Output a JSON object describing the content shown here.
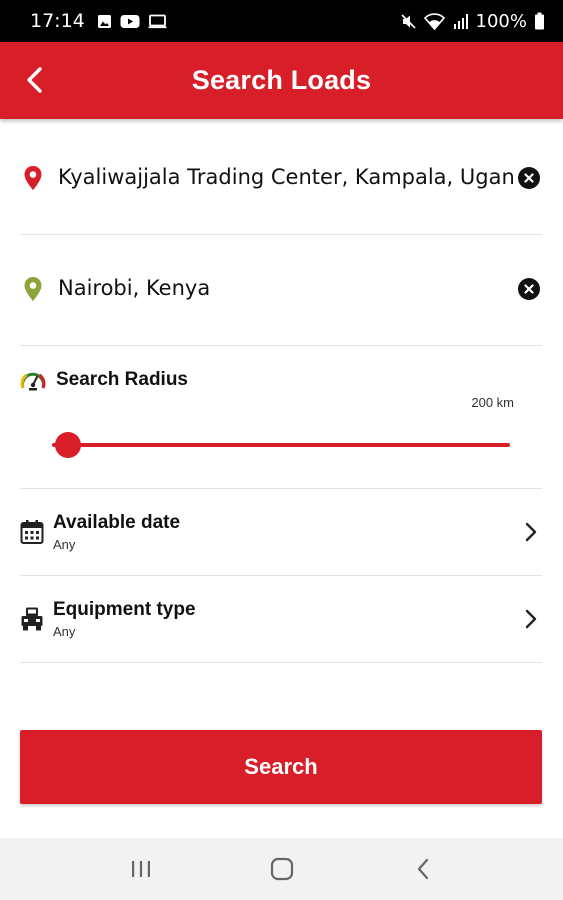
{
  "status_bar": {
    "time": "17:14",
    "battery": "100%",
    "left_icons": [
      "image-icon",
      "youtube-icon",
      "cast-icon"
    ],
    "right_icons": [
      "mute-icon",
      "wifi-icon",
      "signal-icon",
      "battery-icon"
    ]
  },
  "header": {
    "title": "Search Loads",
    "back_icon": "back-arrow-icon"
  },
  "origin": {
    "value": "Kyaliwajjala Trading Center, Kampala, Uganda",
    "pin_color": "#d81e28",
    "clear_icon": "clear-icon"
  },
  "destination": {
    "value": "Nairobi, Kenya",
    "pin_color": "#8da43a",
    "clear_icon": "clear-icon"
  },
  "radius": {
    "title": "Search Radius",
    "value_label": "200 km",
    "slider_fraction": 0.0,
    "icon": "speedometer-icon"
  },
  "options": [
    {
      "title": "Available date",
      "value": "Any",
      "icon": "calendar-icon"
    },
    {
      "title": "Equipment type",
      "value": "Any",
      "icon": "truck-icon"
    }
  ],
  "search_button": {
    "label": "Search"
  },
  "nav": {
    "icons": [
      "recent-apps-icon",
      "home-icon",
      "back-icon"
    ]
  },
  "colors": {
    "accent": "#d81e28",
    "destination_pin": "#8da43a"
  }
}
